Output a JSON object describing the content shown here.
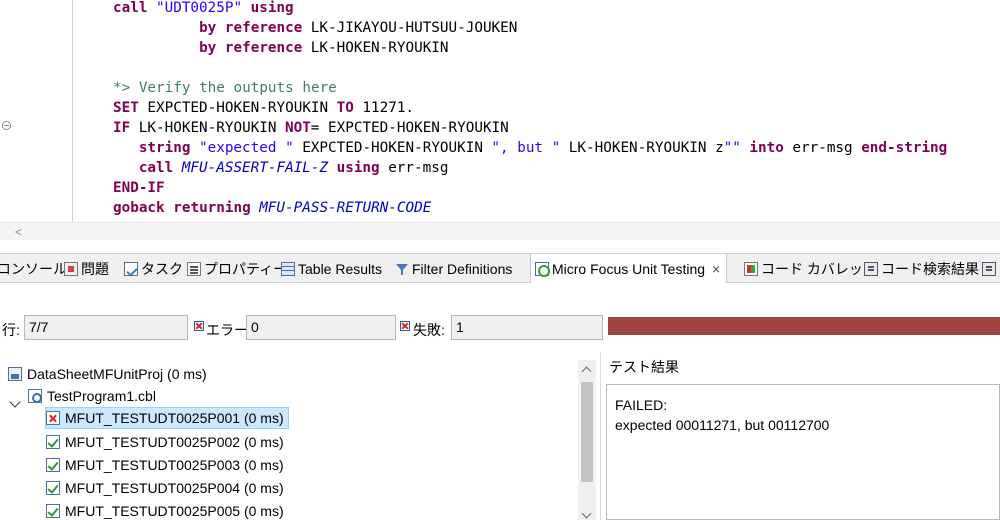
{
  "editor": {
    "lines": [
      [
        {
          "c": "kw",
          "t": "call "
        },
        {
          "c": "str",
          "t": "\"UDT0025P\""
        },
        {
          "c": "kw",
          "t": " using"
        }
      ],
      [
        {
          "c": "kw",
          "t": "          by reference "
        },
        {
          "c": "pl",
          "t": "LK-JIKAYOU-HUTSUU-JOUKEN"
        }
      ],
      [
        {
          "c": "kw",
          "t": "          by reference "
        },
        {
          "c": "pl",
          "t": "LK-HOKEN-RYOUKIN"
        }
      ],
      [],
      [
        {
          "c": "cmt",
          "t": "*> Verify the outputs here"
        }
      ],
      [
        {
          "c": "kw",
          "t": "SET "
        },
        {
          "c": "pl",
          "t": "EXPCTED-HOKEN-RYOUKIN "
        },
        {
          "c": "kw",
          "t": "TO "
        },
        {
          "c": "pl",
          "t": "11271."
        }
      ],
      [
        {
          "c": "kw",
          "t": "IF "
        },
        {
          "c": "pl",
          "t": "LK-HOKEN-RYOUKIN "
        },
        {
          "c": "kw",
          "t": "NOT"
        },
        {
          "c": "pl",
          "t": "= EXPCTED-HOKEN-RYOUKIN"
        }
      ],
      [
        {
          "c": "kw",
          "t": "   string "
        },
        {
          "c": "str",
          "t": "\"expected \""
        },
        {
          "c": "pl",
          "t": " EXPCTED-HOKEN-RYOUKIN "
        },
        {
          "c": "str",
          "t": "\", but \""
        },
        {
          "c": "pl",
          "t": " LK-HOKEN-RYOUKIN z"
        },
        {
          "c": "str",
          "t": "\"\""
        },
        {
          "c": "kw",
          "t": " into "
        },
        {
          "c": "pl",
          "t": "err-msg "
        },
        {
          "c": "kw",
          "t": "end-string"
        }
      ],
      [
        {
          "c": "kw",
          "t": "   call "
        },
        {
          "c": "it",
          "t": "MFU-ASSERT-FAIL-Z"
        },
        {
          "c": "kw",
          "t": " using "
        },
        {
          "c": "pl",
          "t": "err-msg"
        }
      ],
      [
        {
          "c": "kw",
          "t": "END-IF"
        }
      ],
      [
        {
          "c": "kw",
          "t": "goback returning "
        },
        {
          "c": "it",
          "t": "MFU-PASS-RETURN-CODE"
        }
      ]
    ]
  },
  "scroll_left_arrow": "<",
  "tabs": [
    {
      "label": "コンソール",
      "icon": "console-icon"
    },
    {
      "label": "問題",
      "icon": "problems-icon"
    },
    {
      "label": "タスク",
      "icon": "tasks-icon"
    },
    {
      "label": "プロパティー",
      "icon": "properties-icon"
    },
    {
      "label": "Table Results",
      "icon": "table-results-icon"
    },
    {
      "label": "Filter Definitions",
      "icon": "filter-icon"
    },
    {
      "label": "Micro Focus Unit Testing",
      "icon": "unit-testing-icon",
      "active": true
    },
    {
      "label": "コード カバレッジ",
      "icon": "code-coverage-icon"
    },
    {
      "label": "コード検索結果",
      "icon": "code-search-icon"
    }
  ],
  "close_glyph": "×",
  "counters": {
    "runs_label": "行:",
    "runs_value": "7/7",
    "errors_label": "エラー:",
    "errors_value": "0",
    "failures_label": "失敗:",
    "failures_value": "1",
    "progress_color": "#a04444"
  },
  "tree": {
    "project": "DataSheetMFUnitProj (0 ms)",
    "program": "TestProgram1.cbl",
    "tests": [
      {
        "label": "MFUT_TESTUDT0025P001 (0 ms)",
        "status": "fail"
      },
      {
        "label": "MFUT_TESTUDT0025P002 (0 ms)",
        "status": "pass"
      },
      {
        "label": "MFUT_TESTUDT0025P003 (0 ms)",
        "status": "pass"
      },
      {
        "label": "MFUT_TESTUDT0025P004 (0 ms)",
        "status": "pass"
      },
      {
        "label": "MFUT_TESTUDT0025P005 (0 ms)",
        "status": "pass"
      }
    ]
  },
  "result": {
    "title": "テスト結果",
    "text": "FAILED:\nexpected 00011271, but 00112700"
  }
}
